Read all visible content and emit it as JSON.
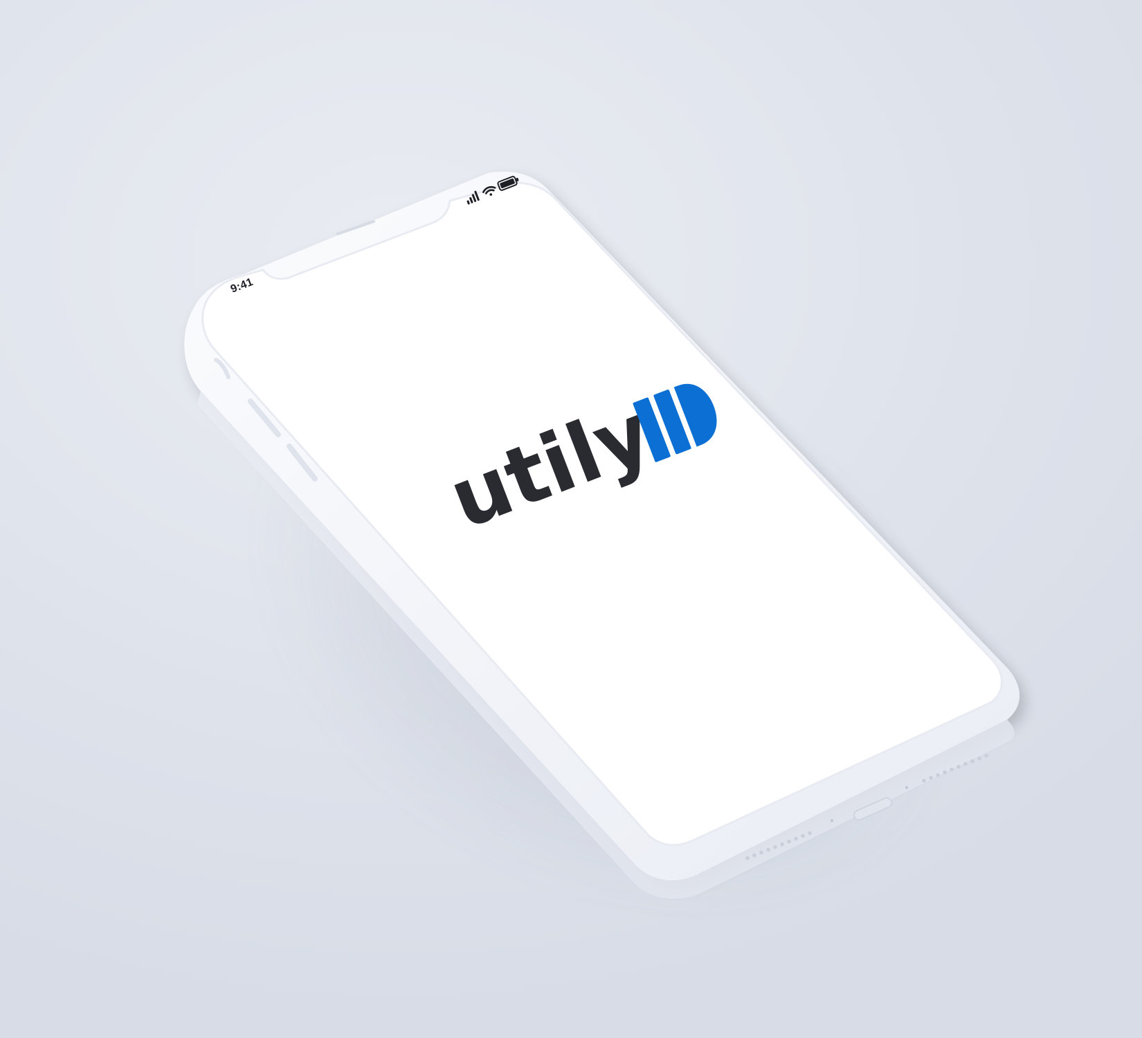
{
  "status_bar": {
    "time": "9:41",
    "signal_icon": "cellular-signal-icon",
    "wifi_icon": "wifi-icon",
    "battery_icon": "battery-icon"
  },
  "app": {
    "logo_wordmark": "utily",
    "logo_mark_icon": "utily-logo-mark-icon",
    "brand_color": "#0b6fd3",
    "text_color": "#2a2b30"
  },
  "device": {
    "frame_color": "#f2f4f8",
    "screen_color": "#ffffff"
  }
}
